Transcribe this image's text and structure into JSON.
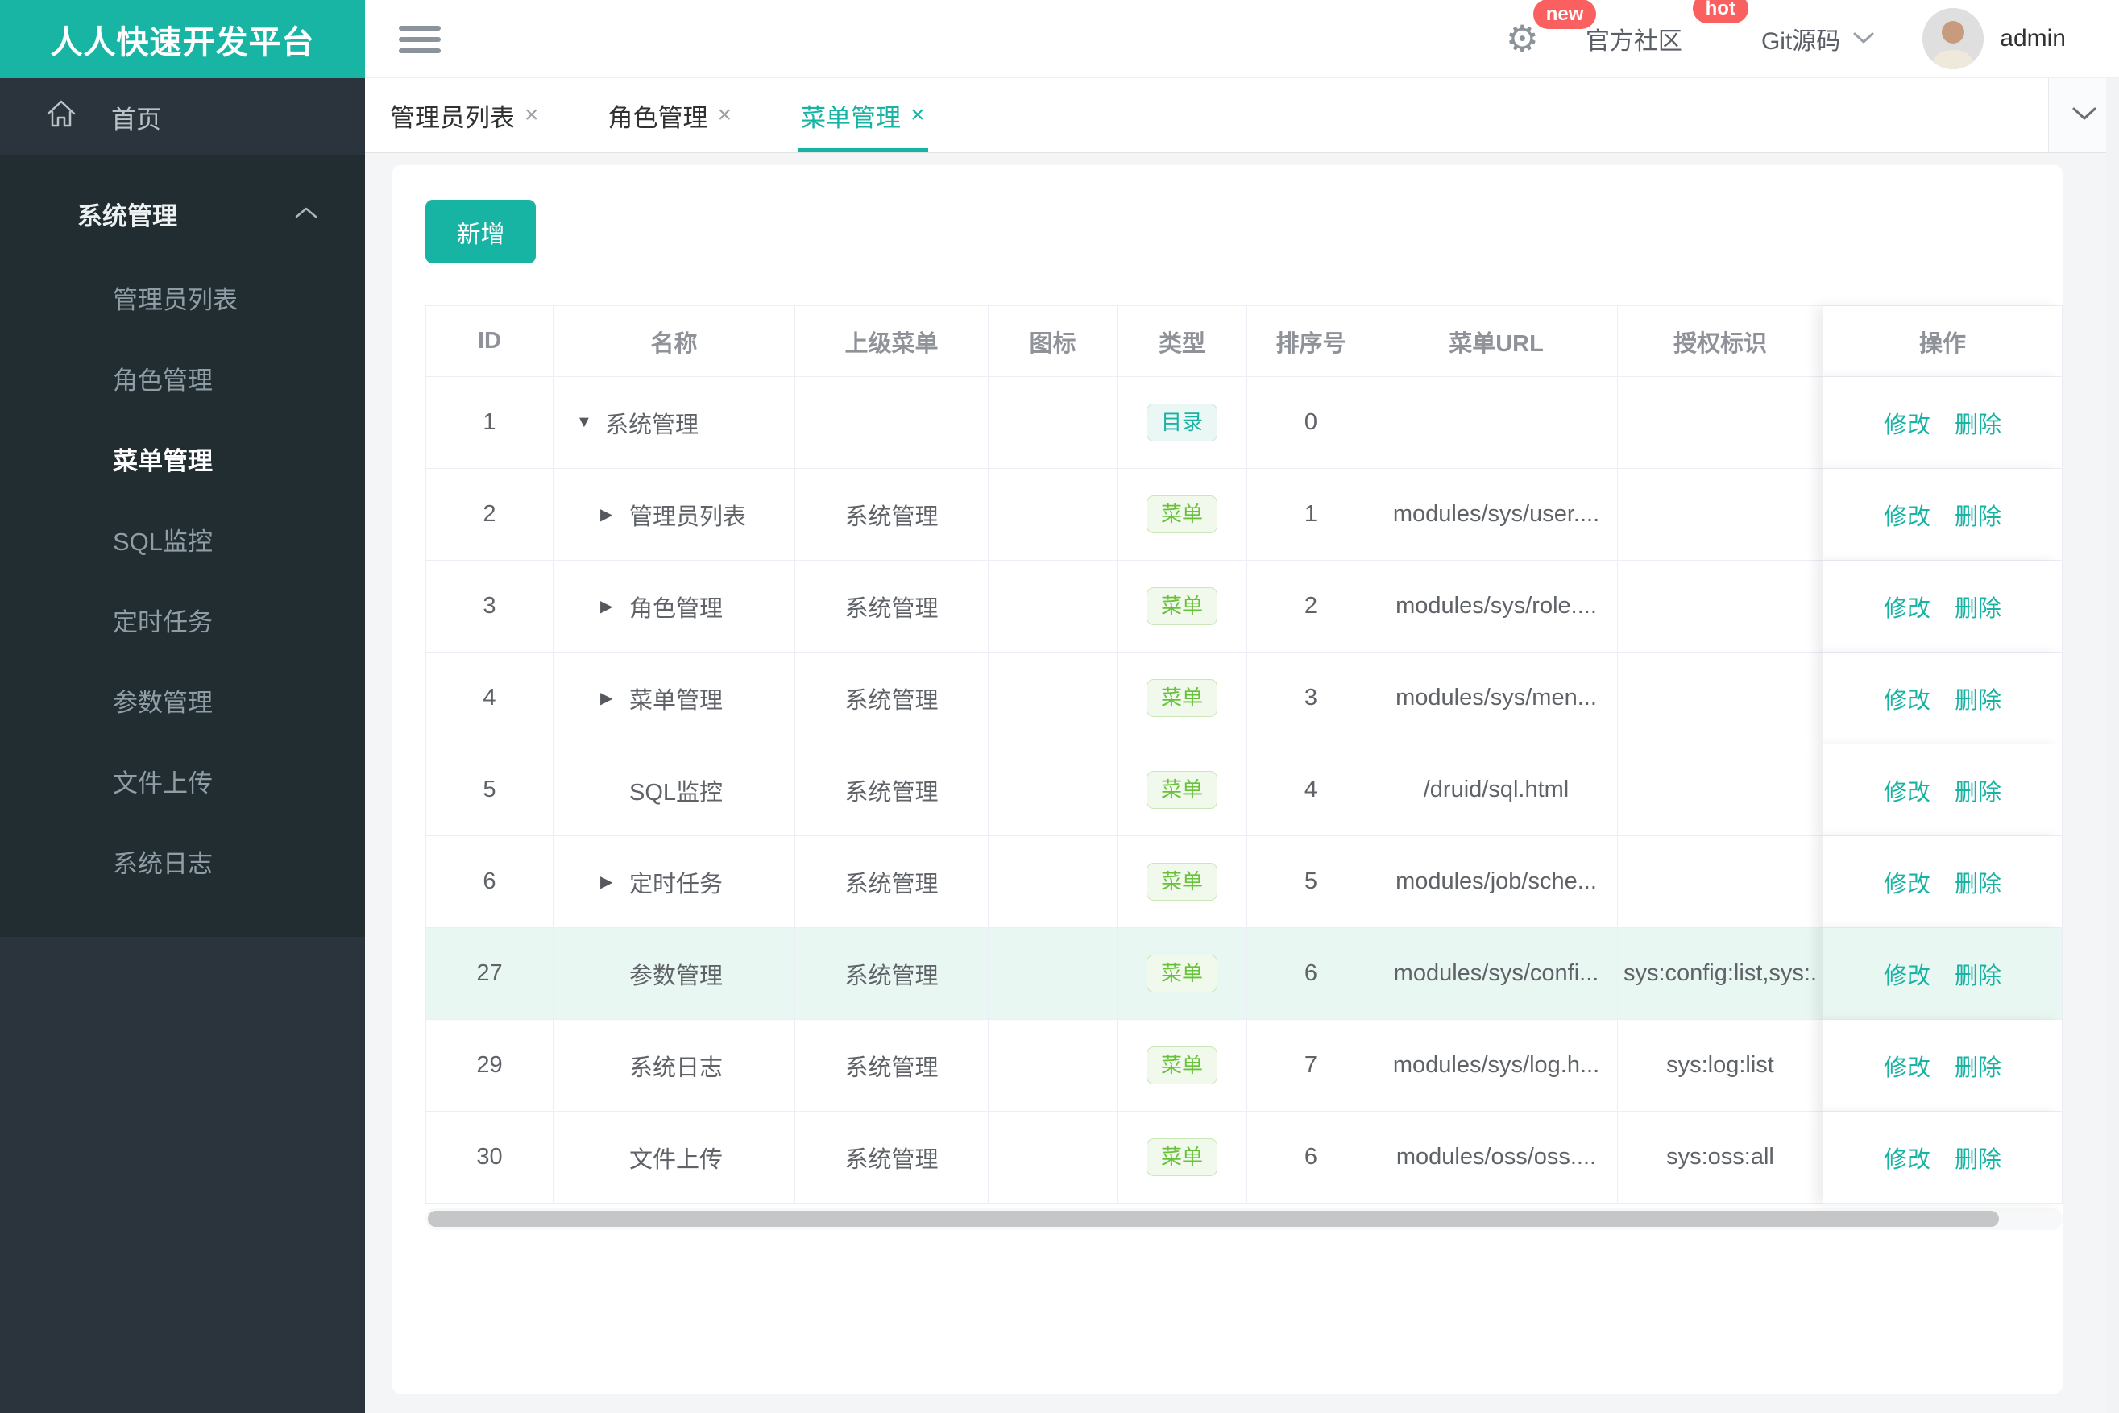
{
  "brand": {
    "title": "人人快速开发平台"
  },
  "topbar": {
    "badge_new": "new",
    "community": "官方社区",
    "badge_hot": "hot",
    "git": "Git源码",
    "username": "admin"
  },
  "sidebar": {
    "home": "首页",
    "group": {
      "label": "系统管理",
      "expanded": true,
      "items": [
        {
          "label": "管理员列表",
          "active": false
        },
        {
          "label": "角色管理",
          "active": false
        },
        {
          "label": "菜单管理",
          "active": true
        },
        {
          "label": "SQL监控",
          "active": false
        },
        {
          "label": "定时任务",
          "active": false
        },
        {
          "label": "参数管理",
          "active": false
        },
        {
          "label": "文件上传",
          "active": false
        },
        {
          "label": "系统日志",
          "active": false
        }
      ]
    }
  },
  "tabs": [
    {
      "label": "管理员列表",
      "active": false
    },
    {
      "label": "角色管理",
      "active": false
    },
    {
      "label": "菜单管理",
      "active": true
    }
  ],
  "toolbar": {
    "add_label": "新增"
  },
  "table": {
    "columns": [
      "ID",
      "名称",
      "上级菜单",
      "图标",
      "类型",
      "排序号",
      "菜单URL",
      "授权标识",
      "操作"
    ],
    "action_labels": {
      "edit": "修改",
      "delete": "删除"
    },
    "rows": [
      {
        "id": "1",
        "arrow": "down",
        "name": "系统管理",
        "parent": "",
        "icon": "",
        "type": "目录",
        "sort": "0",
        "url": "",
        "perms": "",
        "highlighted": false
      },
      {
        "id": "2",
        "arrow": "right",
        "name": "管理员列表",
        "parent": "系统管理",
        "icon": "",
        "type": "菜单",
        "sort": "1",
        "url": "modules/sys/user....",
        "perms": "",
        "highlighted": false
      },
      {
        "id": "3",
        "arrow": "right",
        "name": "角色管理",
        "parent": "系统管理",
        "icon": "",
        "type": "菜单",
        "sort": "2",
        "url": "modules/sys/role....",
        "perms": "",
        "highlighted": false
      },
      {
        "id": "4",
        "arrow": "right",
        "name": "菜单管理",
        "parent": "系统管理",
        "icon": "",
        "type": "菜单",
        "sort": "3",
        "url": "modules/sys/men...",
        "perms": "",
        "highlighted": false
      },
      {
        "id": "5",
        "arrow": "none",
        "name": "SQL监控",
        "parent": "系统管理",
        "icon": "",
        "type": "菜单",
        "sort": "4",
        "url": "/druid/sql.html",
        "perms": "",
        "highlighted": false
      },
      {
        "id": "6",
        "arrow": "right",
        "name": "定时任务",
        "parent": "系统管理",
        "icon": "",
        "type": "菜单",
        "sort": "5",
        "url": "modules/job/sche...",
        "perms": "",
        "highlighted": false
      },
      {
        "id": "27",
        "arrow": "none",
        "name": "参数管理",
        "parent": "系统管理",
        "icon": "",
        "type": "菜单",
        "sort": "6",
        "url": "modules/sys/confi...",
        "perms": "sys:config:list,sys:.",
        "highlighted": true
      },
      {
        "id": "29",
        "arrow": "none",
        "name": "系统日志",
        "parent": "系统管理",
        "icon": "",
        "type": "菜单",
        "sort": "7",
        "url": "modules/sys/log.h...",
        "perms": "sys:log:list",
        "highlighted": false
      },
      {
        "id": "30",
        "arrow": "none",
        "name": "文件上传",
        "parent": "系统管理",
        "icon": "",
        "type": "菜单",
        "sort": "6",
        "url": "modules/oss/oss....",
        "perms": "sys:oss:all",
        "highlighted": false
      }
    ]
  },
  "colors": {
    "accent": "#17b3a3",
    "logo_bg": "#18b4a4",
    "badge_bg": "#fa6060",
    "sidebar_bg": "#2b343c",
    "sidebar_submenu_bg": "#222d32",
    "tag_dir_text": "#1cb2a3",
    "tag_dir_bg": "#eaf7f5",
    "tag_menu_text": "#67c23a",
    "tag_menu_bg": "#f0f9eb",
    "highlight_row_bg": "#e9f7f2",
    "table_border": "#ebeef5",
    "header_text": "#8f9399",
    "cell_text": "#5f6368"
  }
}
